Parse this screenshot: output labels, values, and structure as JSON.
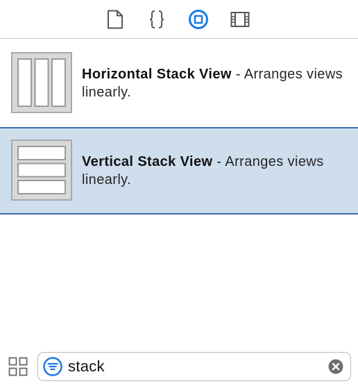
{
  "tabs": [
    {
      "icon": "file-icon",
      "active": false
    },
    {
      "icon": "code-braces-icon",
      "active": false
    },
    {
      "icon": "object-library-icon",
      "active": true
    },
    {
      "icon": "media-film-icon",
      "active": false
    }
  ],
  "library": {
    "items": [
      {
        "title": "Horizontal Stack View",
        "separator": " - ",
        "description": "Arranges views linearly.",
        "icon": "horizontal-stack-view-icon",
        "selected": false
      },
      {
        "title": "Vertical Stack View",
        "separator": " - ",
        "description": "Arranges views linearly.",
        "icon": "vertical-stack-view-icon",
        "selected": true
      }
    ]
  },
  "search": {
    "value": "stack",
    "placeholder": "Filter"
  },
  "colors": {
    "accent": "#1b7ae6",
    "selection_bg": "#cfdeed",
    "selection_border": "#3f6eaa"
  }
}
